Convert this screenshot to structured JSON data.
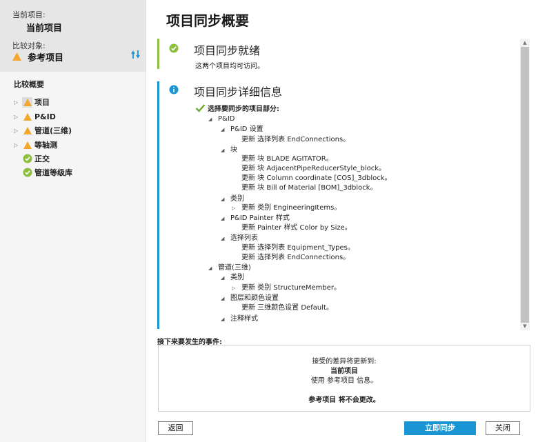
{
  "sidebar": {
    "current_label": "当前项目:",
    "current_value": "当前项目",
    "compare_label": "比较对象:",
    "compare_value": "参考项目",
    "overview_title": "比较概要",
    "items": [
      {
        "label": "项目",
        "icon": "warning-icon",
        "expandable": true
      },
      {
        "label": "P&ID",
        "icon": "warning-icon",
        "expandable": true
      },
      {
        "label": "管道(三维)",
        "icon": "warning-icon",
        "expandable": true
      },
      {
        "label": "等轴测",
        "icon": "warning-icon",
        "expandable": true
      },
      {
        "label": "正交",
        "icon": "check-circle-icon",
        "expandable": false
      },
      {
        "label": "管道等级库",
        "icon": "check-circle-icon",
        "expandable": false
      }
    ]
  },
  "main": {
    "title": "项目同步概要",
    "ready": {
      "title": "项目同步就绪",
      "subtitle": "这两个项目均可访问。"
    },
    "details": {
      "title": "项目同步详细信息",
      "check_label": "选择要同步的项目部分:",
      "tree": [
        {
          "text": "P&ID",
          "toggle": "expanded"
        },
        {
          "text": "P&ID 设置",
          "toggle": "expanded"
        },
        {
          "text": "更新 选择列表 EndConnections。",
          "toggle": "none"
        },
        {
          "text": "块",
          "toggle": "expanded"
        },
        {
          "text": "更新 块 BLADE AGITATOR。",
          "toggle": "none"
        },
        {
          "text": "更新 块 AdjacentPipeReducerStyle_block。",
          "toggle": "none"
        },
        {
          "text": "更新 块 Column coordinate [COS]_3dblock。",
          "toggle": "none"
        },
        {
          "text": "更新 块 Bill of Material [BOM]_3dblock。",
          "toggle": "none"
        },
        {
          "text": "类别",
          "toggle": "expanded"
        },
        {
          "text": "更新 类别 EngineeringItems。",
          "toggle": "collapsed"
        },
        {
          "text": "P&ID Painter 样式",
          "toggle": "expanded"
        },
        {
          "text": "更新 Painter 样式 Color by Size。",
          "toggle": "none"
        },
        {
          "text": "选择列表",
          "toggle": "expanded"
        },
        {
          "text": "更新 选择列表 Equipment_Types。",
          "toggle": "none"
        },
        {
          "text": "更新 选择列表 EndConnections。",
          "toggle": "none"
        },
        {
          "text": "管道(三维)",
          "toggle": "expanded"
        },
        {
          "text": "类别",
          "toggle": "expanded"
        },
        {
          "text": "更新 类别 StructureMember。",
          "toggle": "collapsed"
        },
        {
          "text": "图层和颜色设置",
          "toggle": "expanded"
        },
        {
          "text": "更新 三维颜色设置 Default。",
          "toggle": "none"
        },
        {
          "text": "注释样式",
          "toggle": "expanded"
        }
      ]
    },
    "next": {
      "label": "接下来要发生的事件:",
      "line1": "接受的差异将更新到:",
      "line2": "当前项目",
      "line3": "使用 参考项目 信息。",
      "line4": "参考项目 将不会更改。"
    }
  },
  "buttons": {
    "back": "返回",
    "sync": "立即同步",
    "close": "关闭"
  },
  "colors": {
    "accent_blue": "#1a94d2",
    "success_green": "#8dbf3f",
    "warning_orange": "#f2a72e"
  }
}
